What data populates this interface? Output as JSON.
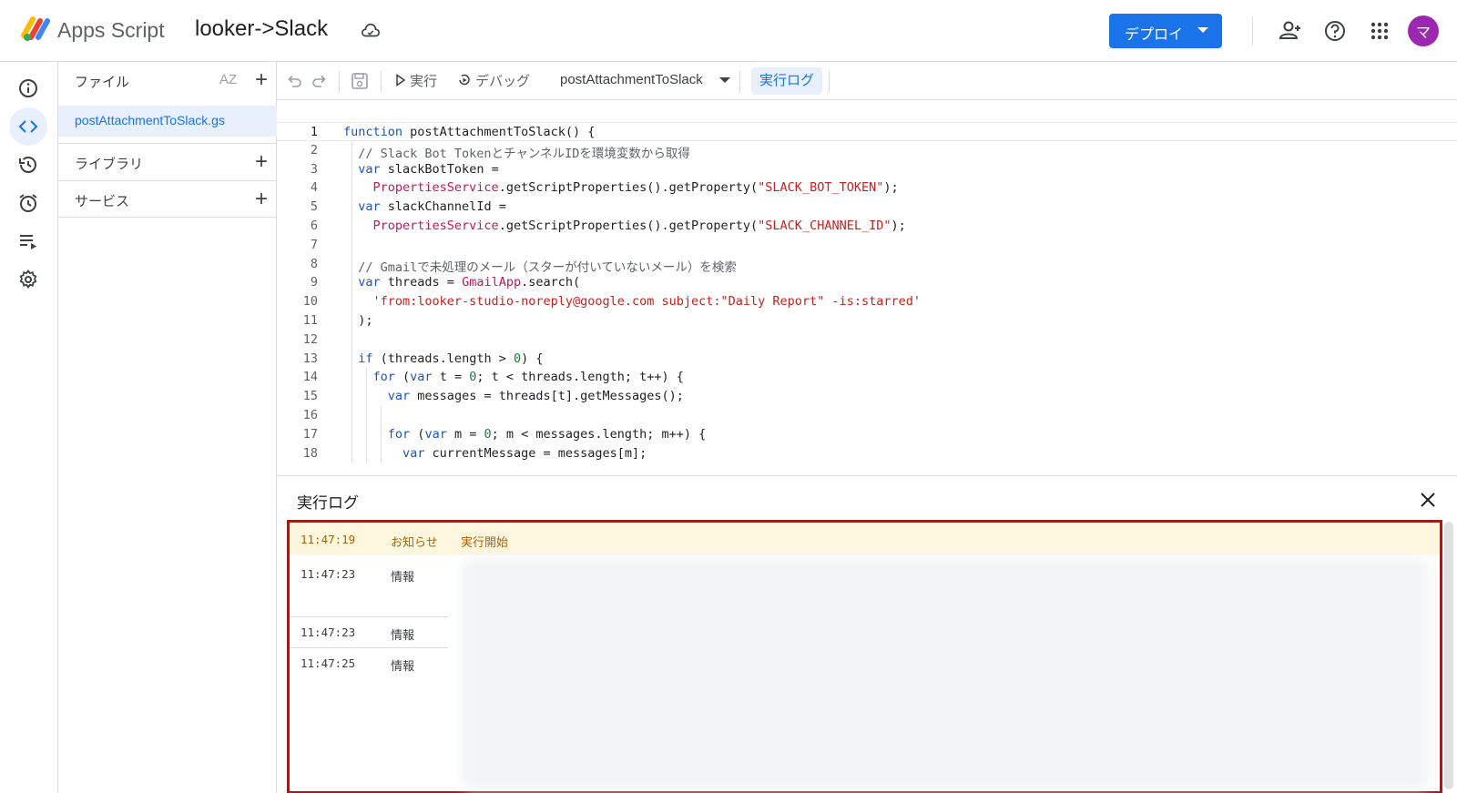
{
  "header": {
    "app_name": "Apps Script",
    "project_title": "looker->Slack",
    "deploy_label": "デプロイ",
    "avatar_initial": "マ",
    "accent_color": "#1a73e8",
    "avatar_color": "#9c27b0"
  },
  "rail": {
    "items": [
      {
        "icon": "info-icon"
      },
      {
        "icon": "code-icon",
        "active": true
      },
      {
        "icon": "history-icon"
      },
      {
        "icon": "alarm-icon"
      },
      {
        "icon": "executions-icon"
      },
      {
        "icon": "gear-icon"
      }
    ]
  },
  "files": {
    "files_label": "ファイル",
    "sort_label": "AZ",
    "file_name": "postAttachmentToSlack.gs",
    "libraries_label": "ライブラリ",
    "services_label": "サービス"
  },
  "toolbar": {
    "run_label": "実行",
    "debug_label": "デバッグ",
    "function_name": "postAttachmentToSlack",
    "log_label": "実行ログ"
  },
  "code_lines": [
    "function postAttachmentToSlack() {",
    "  // Slack Bot TokenとチャンネルIDを環境変数から取得",
    "  var slackBotToken =",
    "    PropertiesService.getScriptProperties().getProperty(\"SLACK_BOT_TOKEN\");",
    "  var slackChannelId =",
    "    PropertiesService.getScriptProperties().getProperty(\"SLACK_CHANNEL_ID\");",
    "",
    "  // Gmailで未処理のメール（スターが付いていないメール）を検索",
    "  var threads = GmailApp.search(",
    "    'from:looker-studio-noreply@google.com subject:\"Daily Report\" -is:starred'",
    "  );",
    "",
    "  if (threads.length > 0) {",
    "    for (var t = 0; t < threads.length; t++) {",
    "      var messages = threads[t].getMessages();",
    "",
    "      for (var m = 0; m < messages.length; m++) {",
    "        var currentMessage = messages[m];"
  ],
  "log": {
    "title": "実行ログ",
    "entries": [
      {
        "time": "11:47:19",
        "level": "お知らせ",
        "message": "実行開始"
      },
      {
        "time": "11:47:23",
        "level": "情報",
        "message": ""
      },
      {
        "time": "11:47:23",
        "level": "情報",
        "message": ""
      },
      {
        "time": "11:47:25",
        "level": "情報",
        "message": ""
      }
    ]
  }
}
